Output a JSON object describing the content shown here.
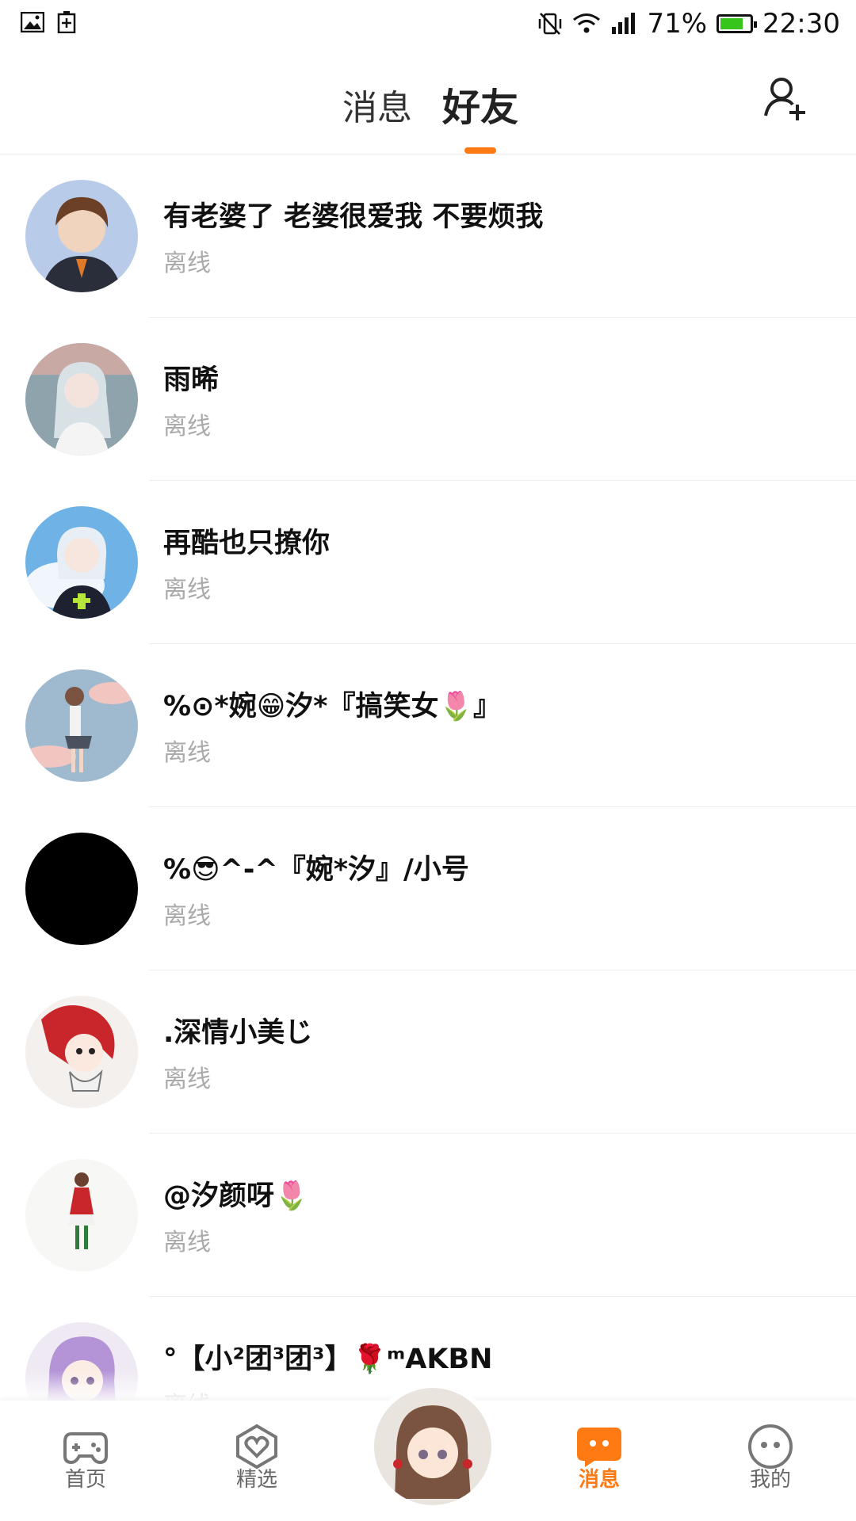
{
  "status_bar": {
    "battery": "71%",
    "time": "22:30"
  },
  "header": {
    "tabs": [
      {
        "label": "消息"
      },
      {
        "label": "好友"
      }
    ],
    "active_tab": "好友",
    "accent": "#ff7a12"
  },
  "friends": [
    {
      "name": "有老婆了 老婆很爱我 不要烦我",
      "status": "离线"
    },
    {
      "name": "雨晞",
      "status": "离线"
    },
    {
      "name": "再酷也只撩你",
      "status": "离线"
    },
    {
      "name": "%⊙*婉😁汐*『搞笑女🌷』",
      "status": "离线"
    },
    {
      "name": "%😎^-^『婉*汐』/小号",
      "status": "离线"
    },
    {
      "name": ".深情小美じ",
      "status": "离线"
    },
    {
      "name": "@汐颜呀🌷",
      "status": "离线"
    },
    {
      "name": "°【小²团³团³】🌹ᵐAKBN",
      "status": "离线"
    }
  ],
  "bottom_nav": {
    "items": [
      {
        "label": "首页",
        "icon": "gamepad-icon"
      },
      {
        "label": "精选",
        "icon": "heart-badge-icon"
      },
      {
        "label": "消息",
        "icon": "chat-bubble-icon"
      },
      {
        "label": "我的",
        "icon": "face-icon"
      }
    ],
    "active": "消息"
  }
}
